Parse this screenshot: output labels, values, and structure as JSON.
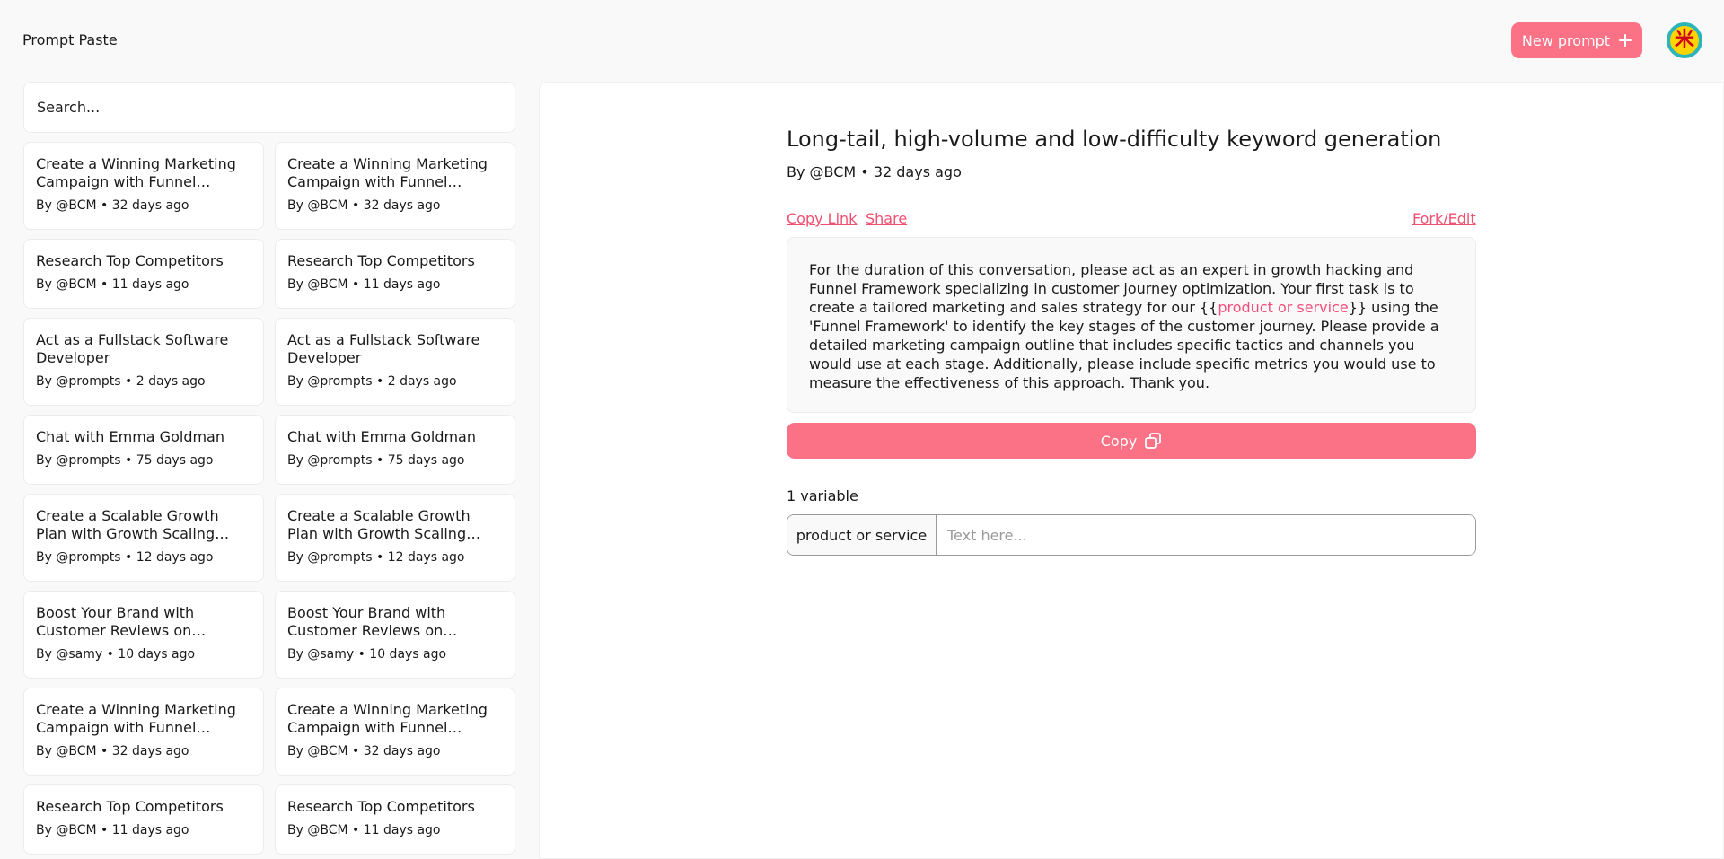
{
  "header": {
    "app_title": "Prompt Paste",
    "new_prompt_label": "New prompt",
    "avatar_glyph": "米"
  },
  "search": {
    "placeholder": "Search...",
    "value": ""
  },
  "sidebar": {
    "cards": [
      {
        "title": "Create a Winning Marketing Campaign with Funnel Framework",
        "meta": "By @BCM • 32 days ago"
      },
      {
        "title": "Create a Winning Marketing Campaign with Funnel Framework",
        "meta": "By @BCM • 32 days ago"
      },
      {
        "title": "Research Top Competitors",
        "meta": "By @BCM • 11 days ago"
      },
      {
        "title": "Research Top Competitors",
        "meta": "By @BCM • 11 days ago"
      },
      {
        "title": "Act as a Fullstack Software Developer",
        "meta": "By @prompts • 2 days ago"
      },
      {
        "title": "Act as a Fullstack Software Developer",
        "meta": "By @prompts • 2 days ago"
      },
      {
        "title": "Chat with Emma Goldman",
        "meta": "By @prompts • 75 days ago"
      },
      {
        "title": "Chat with Emma Goldman",
        "meta": "By @prompts • 75 days ago"
      },
      {
        "title": "Create a Scalable Growth Plan with Growth Scaling Framework",
        "meta": "By @prompts • 12 days ago"
      },
      {
        "title": "Create a Scalable Growth Plan with Growth Scaling Framework",
        "meta": "By @prompts • 12 days ago"
      },
      {
        "title": "Boost Your Brand with Customer Reviews on Instagram",
        "meta": "By @samy • 10 days ago"
      },
      {
        "title": "Boost Your Brand with Customer Reviews on Instagram",
        "meta": "By @samy • 10 days ago"
      },
      {
        "title": "Create a Winning Marketing Campaign with Funnel Framework",
        "meta": "By @BCM • 32 days ago"
      },
      {
        "title": "Create a Winning Marketing Campaign with Funnel Framework",
        "meta": "By @BCM • 32 days ago"
      },
      {
        "title": "Research Top Competitors",
        "meta": "By @BCM • 11 days ago"
      },
      {
        "title": "Research Top Competitors",
        "meta": "By @BCM • 11 days ago"
      }
    ]
  },
  "prompt": {
    "title": "Long-tail, high-volume and low-difficulty keyword generation",
    "meta": "By @BCM • 32 days ago",
    "copy_link_label": "Copy Link",
    "share_label": "Share",
    "fork_edit_label": "Fork/Edit",
    "body_before": "For the duration of this conversation, please act as an expert in growth hacking and Funnel Framework specializing in customer journey optimization. Your first task is to create a tailored marketing and sales strategy for our {{",
    "body_variable": "product or service",
    "body_after": "}} using the 'Funnel Framework' to identify the key stages of the customer journey. Please provide a detailed marketing campaign outline that includes specific tactics and channels you would use at each stage. Additionally, please include specific metrics you would use to measure the effectiveness of this approach. Thank you.",
    "copy_label": "Copy"
  },
  "variables": {
    "count_label": "1 variable",
    "items": [
      {
        "name": "product or service",
        "placeholder": "Text here...",
        "value": ""
      }
    ]
  },
  "colors": {
    "accent": "#fb7185",
    "link": "#f05070",
    "avatar_ring": "#2bb5b9",
    "avatar_fill": "#ffd400",
    "avatar_glyph": "#d0021b"
  }
}
